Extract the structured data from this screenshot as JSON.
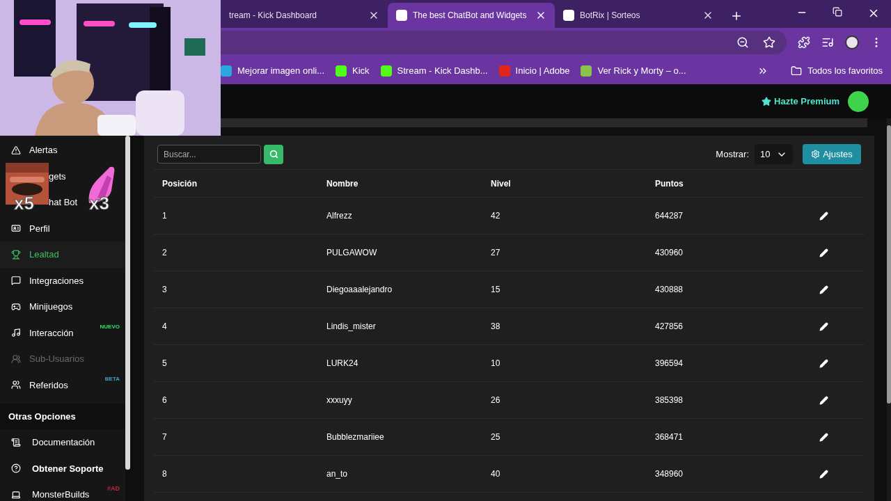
{
  "overlay": {
    "multipliers": [
      "x5",
      "x3"
    ]
  },
  "browser": {
    "tabs": [
      {
        "title": "tream - Kick Dashboard",
        "selected": false
      },
      {
        "title": "The best ChatBot and Widgets",
        "selected": true
      },
      {
        "title": "BotRix | Sorteos",
        "selected": false
      }
    ],
    "bookmarks": [
      "Mejorar imagen onli...",
      "Kick",
      "Stream - Kick Dashb...",
      "Inicio | Adobe",
      "Ver Rick y Morty – o..."
    ],
    "all_bookmarks": "Todos los favoritos"
  },
  "header": {
    "premium": "Hazte Premium"
  },
  "sidebar": {
    "items": [
      {
        "label": "Alertas",
        "kind": "item",
        "selected": false,
        "disabled": false
      },
      {
        "label": "gets",
        "kind": "partial",
        "selected": false,
        "disabled": false
      },
      {
        "label": "hat Bot",
        "kind": "partial",
        "selected": false,
        "disabled": false
      },
      {
        "label": "Perfil",
        "kind": "item",
        "selected": false,
        "disabled": false
      },
      {
        "label": "Lealtad",
        "kind": "item",
        "selected": true,
        "disabled": false
      },
      {
        "label": "Integraciones",
        "kind": "item",
        "selected": false,
        "disabled": false
      },
      {
        "label": "Minijuegos",
        "kind": "item",
        "selected": false,
        "disabled": false
      },
      {
        "label": "Interacción",
        "kind": "item",
        "selected": false,
        "disabled": false,
        "badge": {
          "text": "NUEVO",
          "color": "#2ee66b"
        }
      },
      {
        "label": "Sub-Usuarios",
        "kind": "item",
        "selected": false,
        "disabled": true
      },
      {
        "label": "Referidos",
        "kind": "item",
        "selected": false,
        "disabled": false,
        "badge": {
          "text": "BETA",
          "color": "#3aa6c4"
        }
      }
    ],
    "section": "Otras Opciones",
    "other_items": [
      {
        "label": "Documentación",
        "bold": false
      },
      {
        "label": "Obtener Soporte",
        "bold": true
      },
      {
        "label": "MonsterBuilds",
        "bold": false,
        "badge": {
          "text": "#AD",
          "color": "#c0263a"
        }
      }
    ]
  },
  "toolbar": {
    "search_placeholder": "Buscar...",
    "show_label": "Mostrar:",
    "show_value": "10",
    "settings_button": "Ajustes"
  },
  "table": {
    "columns": [
      "Posición",
      "Nombre",
      "Nivel",
      "Puntos"
    ],
    "rows": [
      [
        "1",
        "Alfrezz",
        "42",
        "644287"
      ],
      [
        "2",
        "PULGAWOW",
        "27",
        "430960"
      ],
      [
        "3",
        "Diegoaaalejandro",
        "15",
        "430888"
      ],
      [
        "4",
        "Lindis_mister",
        "38",
        "427856"
      ],
      [
        "5",
        "LURK24",
        "10",
        "396594"
      ],
      [
        "6",
        "xxxuyy",
        "26",
        "385398"
      ],
      [
        "7",
        "Bubblezmariiee",
        "25",
        "368471"
      ],
      [
        "8",
        "an_to",
        "40",
        "348960"
      ]
    ]
  }
}
